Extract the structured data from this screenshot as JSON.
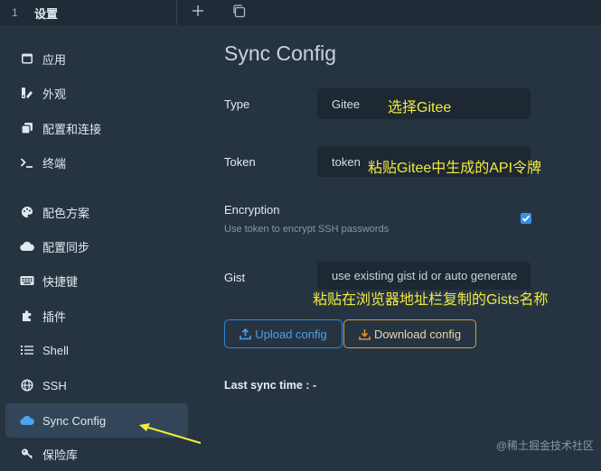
{
  "tab": {
    "number": "1",
    "title": "设置"
  },
  "toolbar": {
    "new_tab_icon": "plus-icon",
    "windows_icon": "window-icon"
  },
  "sidebar": {
    "items": [
      {
        "label": "应用",
        "icon": "application-icon"
      },
      {
        "label": "外观",
        "icon": "appearance-icon"
      },
      {
        "label": "配置和连接",
        "icon": "profiles-icon"
      },
      {
        "label": "终端",
        "icon": "terminal-icon"
      },
      {
        "label": "配色方案",
        "icon": "palette-icon"
      },
      {
        "label": "配置同步",
        "icon": "cloud-icon"
      },
      {
        "label": "快捷键",
        "icon": "keyboard-icon"
      },
      {
        "label": "插件",
        "icon": "puzzle-icon"
      },
      {
        "label": "Shell",
        "icon": "list-icon"
      },
      {
        "label": "SSH",
        "icon": "globe-icon"
      },
      {
        "label": "Sync Config",
        "icon": "cloud-icon",
        "active": true
      },
      {
        "label": "保险库",
        "icon": "key-icon"
      }
    ]
  },
  "main": {
    "title": "Sync Config",
    "type": {
      "label": "Type",
      "value": "Gitee"
    },
    "token": {
      "label": "Token",
      "value": "token"
    },
    "encryption": {
      "label": "Encryption",
      "description": "Use token to encrypt SSH passwords",
      "checked": true
    },
    "gist": {
      "label": "Gist",
      "placeholder": "use existing gist id or auto generate"
    },
    "upload_label": "Upload config",
    "download_label": "Download config",
    "last_sync": "Last sync time : -"
  },
  "annotations": {
    "type_note": "选择Gitee",
    "token_note": "粘贴Gitee中生成的API令牌",
    "gist_note": "粘贴在浏览器地址栏复制的Gists名称"
  },
  "watermark": "@稀土掘金技术社区",
  "colors": {
    "accent": "#3b8fe6",
    "annotation": "#f2ea3c",
    "download_border": "#d99a3c"
  }
}
